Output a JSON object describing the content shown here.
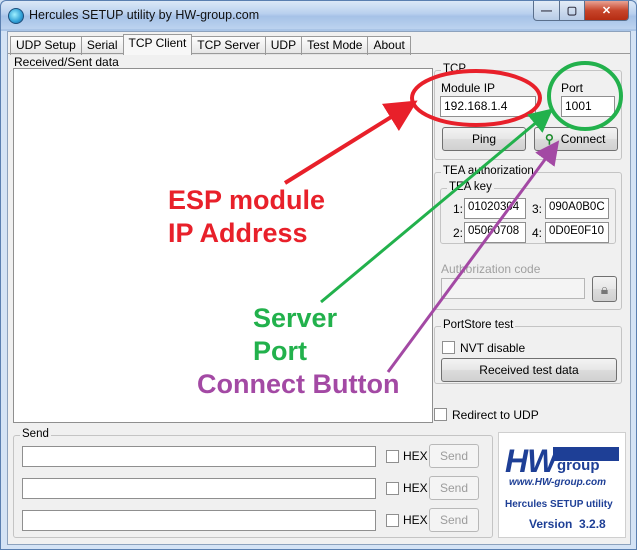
{
  "window": {
    "title": "Hercules SETUP utility by HW-group.com",
    "controls": {
      "minimize": "—",
      "maximize": "▢",
      "close": "✕"
    }
  },
  "tabs": [
    {
      "label": "UDP Setup"
    },
    {
      "label": "Serial"
    },
    {
      "label": "TCP Client",
      "active": true
    },
    {
      "label": "TCP Server"
    },
    {
      "label": "UDP"
    },
    {
      "label": "Test Mode"
    },
    {
      "label": "About"
    }
  ],
  "received_sent": {
    "label": "Received/Sent data",
    "content": ""
  },
  "tcp": {
    "group_title": "TCP",
    "module_ip_label": "Module IP",
    "module_ip_value": "192.168.1.4",
    "port_label": "Port",
    "port_value": "1001",
    "ping_button": "Ping",
    "connect_button": "Connect"
  },
  "tea": {
    "group_title": "TEA authorization",
    "key_title": "TEA key",
    "keys": [
      {
        "num": "1:",
        "value": "01020304"
      },
      {
        "num": "3:",
        "value": "090A0B0C"
      },
      {
        "num": "2:",
        "value": "05060708"
      },
      {
        "num": "4:",
        "value": "0D0E0F10"
      }
    ],
    "auth_code_label": "Authorization code",
    "auth_code_value": ""
  },
  "portstore": {
    "group_title": "PortStore test",
    "nvt_disable": "NVT disable",
    "received_test_data_button": "Received test data"
  },
  "redirect_udp": "Redirect to UDP",
  "send": {
    "group_title": "Send",
    "rows": [
      {
        "value": "",
        "hex_label": "HEX",
        "send_label": "Send"
      },
      {
        "value": "",
        "hex_label": "HEX",
        "send_label": "Send"
      },
      {
        "value": "",
        "hex_label": "HEX",
        "send_label": "Send"
      }
    ]
  },
  "logo": {
    "brand_hw": "HW",
    "brand_group": "group",
    "url": "www.HW-group.com",
    "product": "Hercules SETUP utility",
    "version": "Version  3.2.8"
  },
  "annotations": {
    "ip_line1": "ESP module",
    "ip_line2": "IP Address",
    "port_line1": "Server",
    "port_line2": "Port",
    "connect": "Connect Button",
    "colors": {
      "red": "#e8202a",
      "green": "#22b14c",
      "purple": "#a349a4"
    }
  }
}
